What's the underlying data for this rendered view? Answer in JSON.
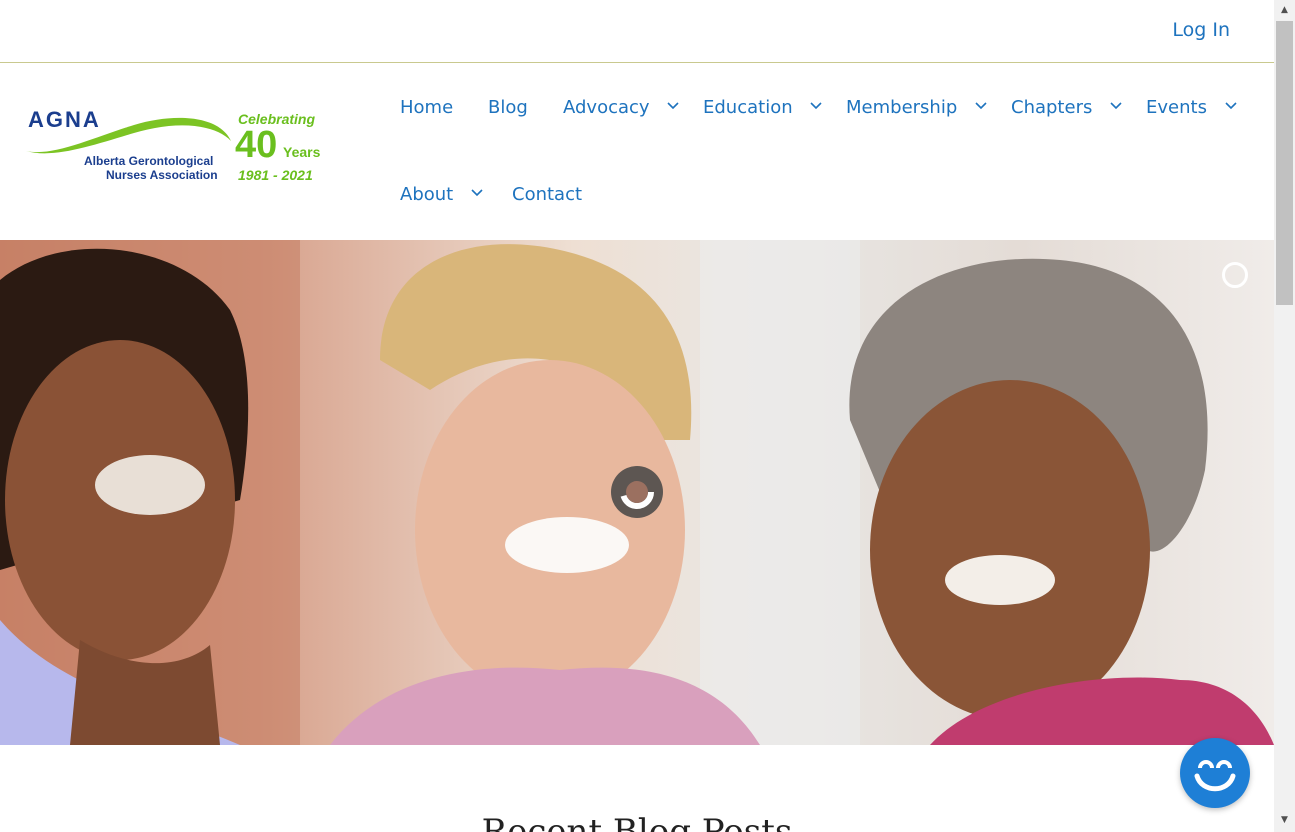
{
  "topbar": {
    "login_label": "Log In"
  },
  "logo": {
    "acronym": "AGNA",
    "name_line1": "Alberta Gerontological",
    "name_line2": "Nurses Association",
    "celebrating": "Celebrating",
    "anniversary_number": "40",
    "anniversary_unit": "Years",
    "dates": "1981 - 2021"
  },
  "nav": {
    "home": "Home",
    "blog": "Blog",
    "advocacy": "Advocacy",
    "education": "Education",
    "membership": "Membership",
    "chapters": "Chapters",
    "events": "Events",
    "about": "About",
    "contact": "Contact"
  },
  "main": {
    "section_title": "Recent Blog Posts"
  },
  "colors": {
    "link": "#1e73be",
    "logo_blue": "#1b3e8e",
    "logo_green": "#6abf1e",
    "chat_button": "#1e7fd6"
  },
  "icons": {
    "dropdown": "chevron-down-icon",
    "chat": "smiley-chat-icon",
    "loading": "spinner-icon",
    "slider_indicator": "ring-icon"
  }
}
